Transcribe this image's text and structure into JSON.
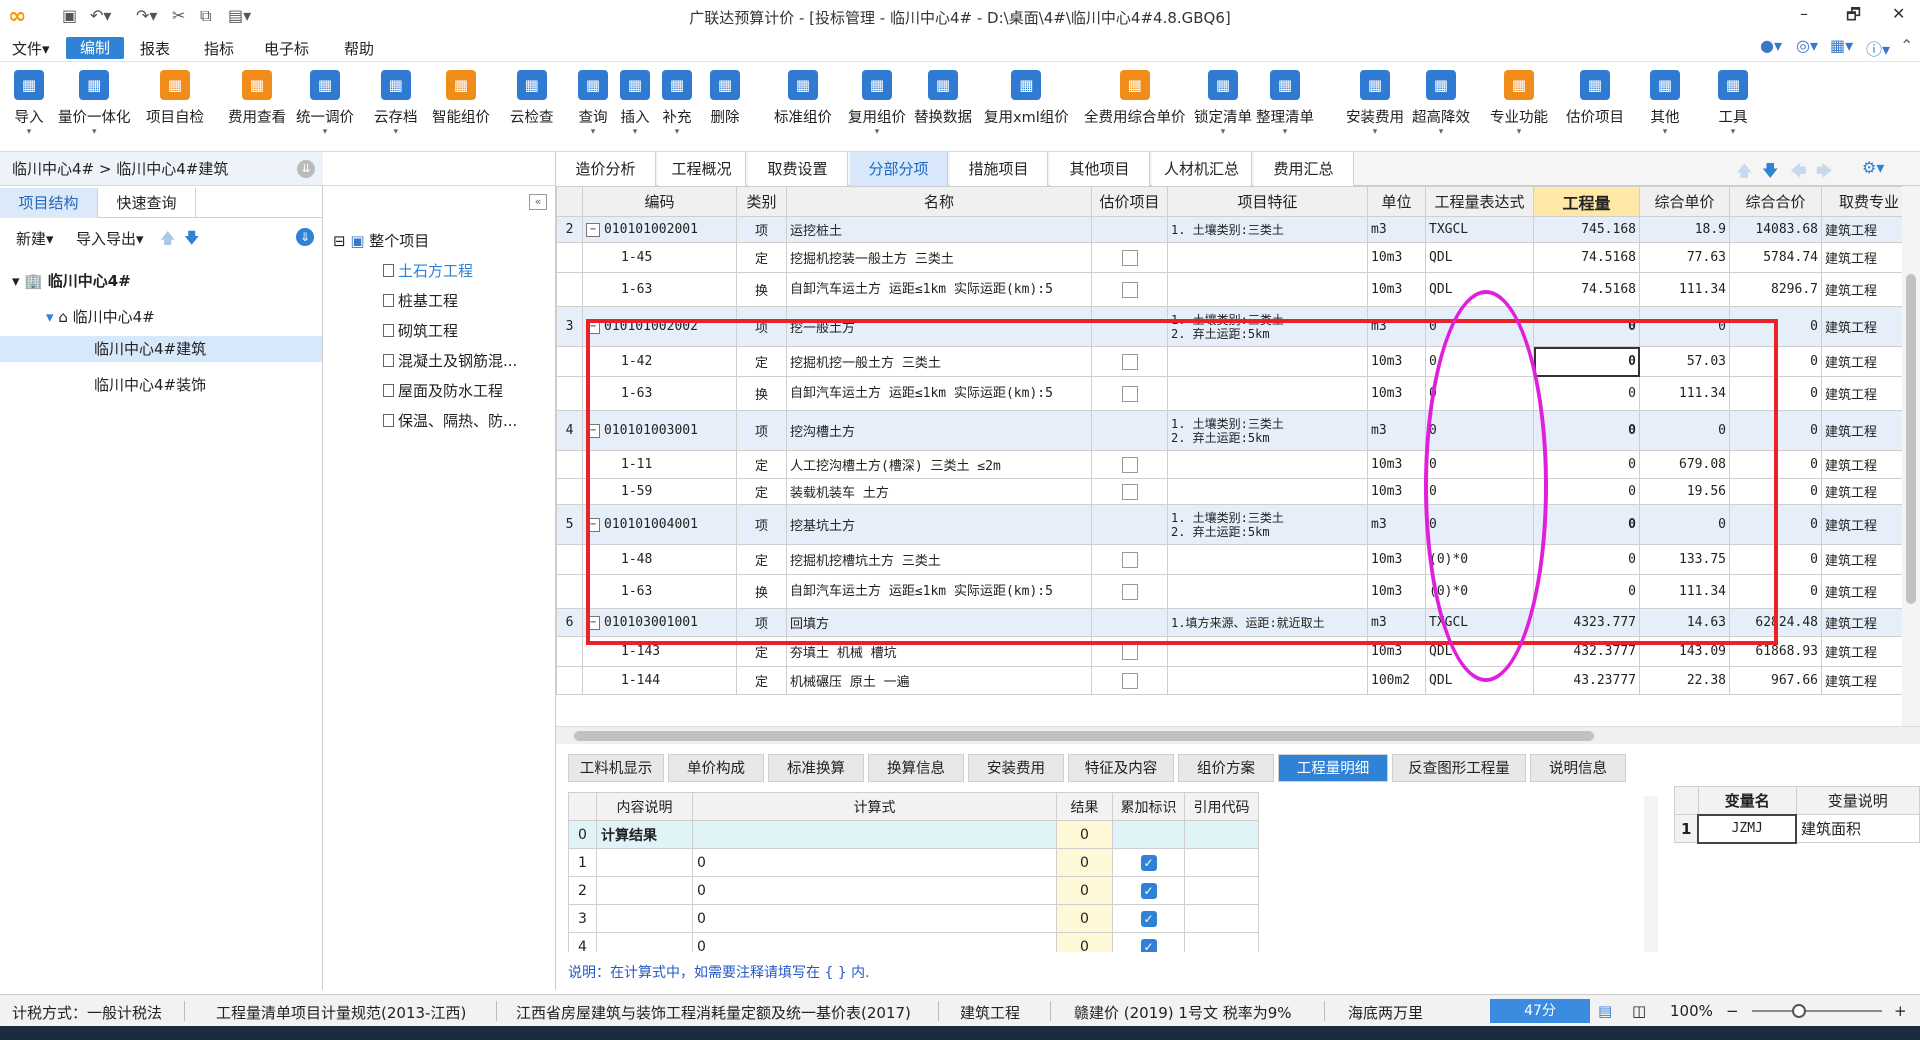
{
  "titlebar": {
    "title": "广联达预算计价 - [投标管理 - 临川中心4# - D:\\桌面\\4#\\临川中心4#4.8.GBQ6]",
    "min": "–",
    "max": "🗗",
    "close": "✕"
  },
  "menu": [
    "文件▾",
    "编制",
    "报表",
    "指标",
    "电子标",
    "帮助"
  ],
  "ribbon": [
    {
      "label": "导入",
      "icon": "import-icon",
      "dd": true
    },
    {
      "label": "量价一体化",
      "icon": "integrate-icon",
      "dd": true
    },
    {
      "label": "项目自检",
      "icon": "check-icon"
    },
    {
      "label": "费用查看",
      "icon": "fee-icon"
    },
    {
      "label": "统一调价",
      "icon": "price-icon",
      "dd": true
    },
    {
      "label": "云存档",
      "icon": "cloud-save-icon",
      "dd": true
    },
    {
      "label": "智能组价",
      "icon": "smart-icon"
    },
    {
      "label": "云检查",
      "icon": "cloud-check-icon"
    },
    {
      "label": "查询",
      "icon": "query-icon",
      "dd": true
    },
    {
      "label": "插入",
      "icon": "insert-icon",
      "dd": true
    },
    {
      "label": "补充",
      "icon": "supplement-icon",
      "dd": true
    },
    {
      "label": "删除",
      "icon": "delete-icon"
    },
    {
      "label": "标准组价",
      "icon": "standard-icon"
    },
    {
      "label": "复用组价",
      "icon": "reuse-icon",
      "dd": true
    },
    {
      "label": "替换数据",
      "icon": "replace-icon"
    },
    {
      "label": "复用xml组价",
      "icon": "xml-icon"
    },
    {
      "label": "全费用综合单价",
      "icon": "fullfee-icon"
    },
    {
      "label": "锁定清单",
      "icon": "lock-icon",
      "dd": true
    },
    {
      "label": "整理清单",
      "icon": "arrange-icon",
      "dd": true
    },
    {
      "label": "安装费用",
      "icon": "install-icon",
      "dd": true
    },
    {
      "label": "超高降效",
      "icon": "height-icon",
      "dd": true
    },
    {
      "label": "专业功能",
      "icon": "pro-icon",
      "dd": true
    },
    {
      "label": "估价项目",
      "icon": "estimate-icon"
    },
    {
      "label": "其他",
      "icon": "other-icon",
      "dd": true
    },
    {
      "label": "工具",
      "icon": "tool-icon",
      "dd": true
    }
  ],
  "left": {
    "breadcrumb": "临川中心4# > 临川中心4#建筑",
    "tabs": [
      "项目结构",
      "快速查询"
    ],
    "new": "新建▾",
    "import_export": "导入导出▾",
    "tree": [
      "临川中心4#",
      "临川中心4#",
      "临川中心4#建筑",
      "临川中心4#装饰"
    ]
  },
  "mid": {
    "root": "整个项目",
    "items": [
      "土石方工程",
      "桩基工程",
      "砌筑工程",
      "混凝土及钢筋混...",
      "屋面及防水工程",
      "保温、隔热、防..."
    ]
  },
  "tabs": [
    "造价分析",
    "工程概况",
    "取费设置",
    "分部分项",
    "措施项目",
    "其他项目",
    "人材机汇总",
    "费用汇总"
  ],
  "grid": {
    "headers": [
      "",
      "编码",
      "类别",
      "名称",
      "估价项目",
      "项目特征",
      "单位",
      "工程量表达式",
      "工程量",
      "综合单价",
      "综合合价",
      "取费专业"
    ],
    "rows": [
      {
        "no": "2",
        "code": "010101002001",
        "type": "项",
        "name": "运挖桩土",
        "feat": "1. 土壤类别:三类土",
        "unit": "m3",
        "expr": "TXGCL",
        "qty": "745.168",
        "price": "18.9",
        "total": "14083.68",
        "pro": "建筑工程",
        "kind": "qd"
      },
      {
        "no": "",
        "code": "1-45",
        "type": "定",
        "name": "挖掘机挖装一般土方 三类土",
        "feat": "",
        "unit": "10m3",
        "expr": "QDL",
        "qty": "74.5168",
        "price": "77.63",
        "total": "5784.74",
        "pro": "建筑工程",
        "kind": "de"
      },
      {
        "no": "",
        "code": "1-63",
        "type": "换",
        "name": "自卸汽车运土方 运距≤1km  实际运距(km):5",
        "feat": "",
        "unit": "10m3",
        "expr": "QDL",
        "qty": "74.5168",
        "price": "111.34",
        "total": "8296.7",
        "pro": "建筑工程",
        "kind": "de"
      },
      {
        "no": "3",
        "code": "010101002002",
        "type": "项",
        "name": "挖一般土方",
        "feat": "1. 土壤类别:三类土\n2. 弃土运距:5km",
        "unit": "m3",
        "expr": "0",
        "qty": "0",
        "price": "0",
        "total": "0",
        "pro": "建筑工程",
        "kind": "qd"
      },
      {
        "no": "",
        "code": "1-42",
        "type": "定",
        "name": "挖掘机挖一般土方 三类土",
        "feat": "",
        "unit": "10m3",
        "expr": "0",
        "qty": "0",
        "price": "57.03",
        "total": "0",
        "pro": "建筑工程",
        "kind": "de"
      },
      {
        "no": "",
        "code": "1-63",
        "type": "换",
        "name": "自卸汽车运土方 运距≤1km  实际运距(km):5",
        "feat": "",
        "unit": "10m3",
        "expr": "0",
        "qty": "0",
        "price": "111.34",
        "total": "0",
        "pro": "建筑工程",
        "kind": "de"
      },
      {
        "no": "4",
        "code": "010101003001",
        "type": "项",
        "name": "挖沟槽土方",
        "feat": "1. 土壤类别:三类土\n2. 弃土运距:5km",
        "unit": "m3",
        "expr": "0",
        "qty": "0",
        "price": "0",
        "total": "0",
        "pro": "建筑工程",
        "kind": "qd"
      },
      {
        "no": "",
        "code": "1-11",
        "type": "定",
        "name": "人工挖沟槽土方(槽深) 三类土 ≤2m",
        "feat": "",
        "unit": "10m3",
        "expr": "0",
        "qty": "0",
        "price": "679.08",
        "total": "0",
        "pro": "建筑工程",
        "kind": "de"
      },
      {
        "no": "",
        "code": "1-59",
        "type": "定",
        "name": "装载机装车 土方",
        "feat": "",
        "unit": "10m3",
        "expr": "0",
        "qty": "0",
        "price": "19.56",
        "total": "0",
        "pro": "建筑工程",
        "kind": "de"
      },
      {
        "no": "5",
        "code": "010101004001",
        "type": "项",
        "name": "挖基坑土方",
        "feat": "1. 土壤类别:三类土\n2. 弃土运距:5km",
        "unit": "m3",
        "expr": "0",
        "qty": "0",
        "price": "0",
        "total": "0",
        "pro": "建筑工程",
        "kind": "qd"
      },
      {
        "no": "",
        "code": "1-48",
        "type": "定",
        "name": "挖掘机挖槽坑土方 三类土",
        "feat": "",
        "unit": "10m3",
        "expr": "(0)*0",
        "qty": "0",
        "price": "133.75",
        "total": "0",
        "pro": "建筑工程",
        "kind": "de"
      },
      {
        "no": "",
        "code": "1-63",
        "type": "换",
        "name": "自卸汽车运土方 运距≤1km  实际运距(km):5",
        "feat": "",
        "unit": "10m3",
        "expr": "(0)*0",
        "qty": "0",
        "price": "111.34",
        "total": "0",
        "pro": "建筑工程",
        "kind": "de"
      },
      {
        "no": "6",
        "code": "010103001001",
        "type": "项",
        "name": "回填方",
        "feat": "1.填方来源、运距:就近取土",
        "unit": "m3",
        "expr": "TXGCL",
        "qty": "4323.777",
        "price": "14.63",
        "total": "62824.48",
        "pro": "建筑工程",
        "kind": "qd"
      },
      {
        "no": "",
        "code": "1-143",
        "type": "定",
        "name": "夯填土 机械 槽坑",
        "feat": "",
        "unit": "10m3",
        "expr": "QDL",
        "qty": "432.3777",
        "price": "143.09",
        "total": "61868.93",
        "pro": "建筑工程",
        "kind": "de"
      },
      {
        "no": "",
        "code": "1-144",
        "type": "定",
        "name": "机械碾压 原土 一遍",
        "feat": "",
        "unit": "100m2",
        "expr": "QDL",
        "qty": "43.23777",
        "price": "22.38",
        "total": "967.66",
        "pro": "建筑工程",
        "kind": "de"
      }
    ]
  },
  "bottom_tabs": [
    "工料机显示",
    "单价构成",
    "标准换算",
    "换算信息",
    "安装费用",
    "特征及内容",
    "组价方案",
    "工程量明细",
    "反查图形工程量",
    "说明信息"
  ],
  "detail": {
    "headers": [
      "",
      "内容说明",
      "计算式",
      "结果",
      "累加标识",
      "引用代码"
    ],
    "rows": [
      {
        "i": "0",
        "desc": "计算结果",
        "expr": "",
        "res": "0",
        "acc": false
      },
      {
        "i": "1",
        "desc": "",
        "expr": "0",
        "res": "0",
        "acc": true
      },
      {
        "i": "2",
        "desc": "",
        "expr": "0",
        "res": "0",
        "acc": true
      },
      {
        "i": "3",
        "desc": "",
        "expr": "0",
        "res": "0",
        "acc": true
      },
      {
        "i": "4",
        "desc": "",
        "expr": "0",
        "res": "0",
        "acc": true
      }
    ],
    "note": "说明：在计算式中，如需要注释请填写在 { } 内."
  },
  "vars": {
    "headers": [
      "",
      "变量名",
      "变量说明"
    ],
    "rows": [
      {
        "i": "1",
        "name": "JZMJ",
        "desc": "建筑面积"
      }
    ]
  },
  "status": [
    "计税方式：一般计税法",
    "工程量清单项目计量规范(2013-江西)",
    "江西省房屋建筑与装饰工程消耗量定额及统一基价表(2017)",
    "建筑工程",
    "赣建价 (2019) 1号文 税率为9%",
    "海底两万里"
  ],
  "timer": "47分",
  "zoom": "100%"
}
